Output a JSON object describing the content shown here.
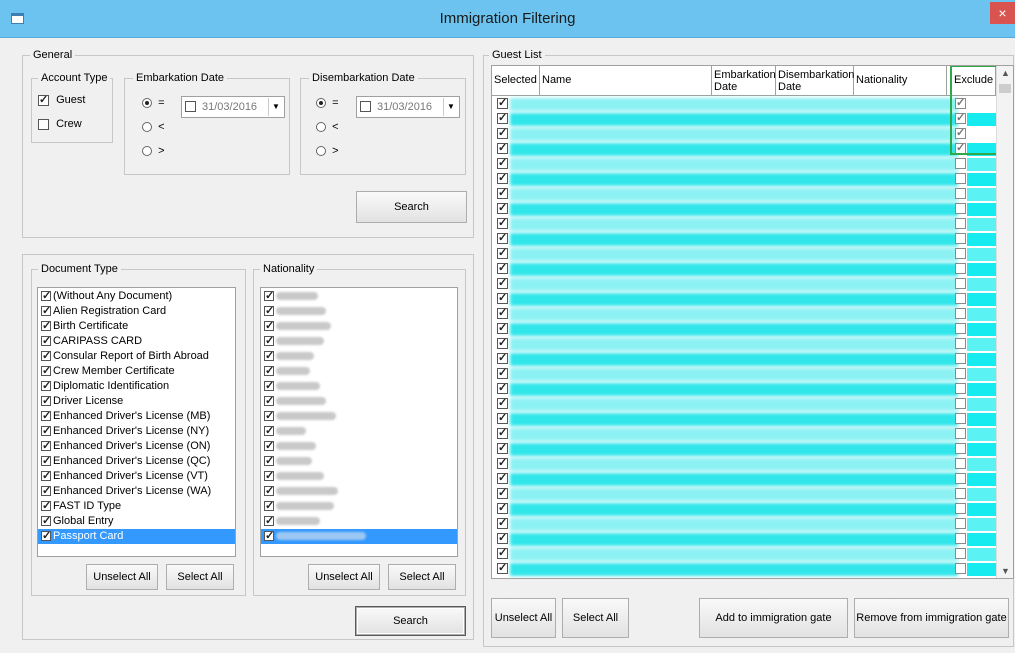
{
  "window": {
    "title": "Immigration Filtering",
    "close": "×"
  },
  "general": {
    "legend": "General",
    "account_type": {
      "legend": "Account Type",
      "guest": "Guest",
      "crew": "Crew"
    },
    "embarkation": {
      "legend": "Embarkation Date",
      "date": "31/03/2016",
      "op_eq": "=",
      "op_lt": "<",
      "op_gt": ">"
    },
    "disembarkation": {
      "legend": "Disembarkation Date",
      "date": "31/03/2016",
      "op_eq": "=",
      "op_lt": "<",
      "op_gt": ">"
    },
    "search": "Search"
  },
  "document_type": {
    "legend": "Document Type",
    "items": [
      "(Without Any Document)",
      "Alien Registration Card",
      "Birth Certificate",
      "CARIPASS CARD",
      "Consular Report of Birth Abroad",
      "Crew Member Certificate",
      "Diplomatic Identification",
      "Driver License",
      "Enhanced Driver's License (MB)",
      "Enhanced Driver's License (NY)",
      "Enhanced Driver's License (ON)",
      "Enhanced Driver's License (QC)",
      "Enhanced Driver's License (VT)",
      "Enhanced Driver's License (WA)",
      "FAST ID Type",
      "Global Entry",
      "Passport Card"
    ],
    "unselect_all": "Unselect All",
    "select_all": "Select All"
  },
  "nationality": {
    "legend": "Nationality",
    "unselect_all": "Unselect All",
    "select_all": "Select All"
  },
  "search_bottom": "Search",
  "guest_list": {
    "legend": "Guest List",
    "headers": {
      "selected": "Selected",
      "name": "Name",
      "embarkation": "Embarkation Date",
      "disembarkation": "Disembarkation Date",
      "nationality": "Nationality",
      "exclude": "Exclude"
    },
    "unselect_all": "Unselect All",
    "select_all": "Select All",
    "add_gate": "Add to immigration gate",
    "remove_gate": "Remove from immigration gate"
  },
  "colors": {
    "titlebar": "#6cc3ef",
    "row_highlight": "#30e6ea",
    "exclude_frame": "#2ea84a",
    "selection": "#3399ff"
  }
}
